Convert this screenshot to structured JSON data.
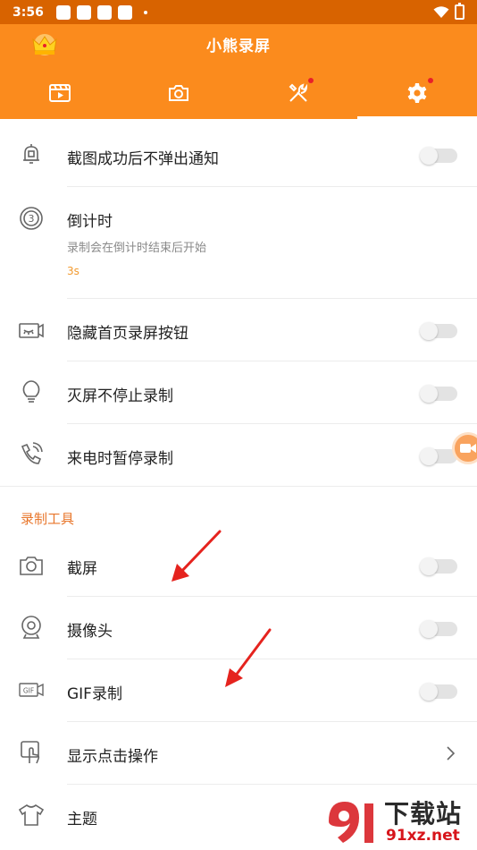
{
  "status_bar": {
    "time": "3:56"
  },
  "app_bar": {
    "title": "小熊录屏",
    "tabs": [
      {
        "icon": "video-list-icon",
        "active": false,
        "badge": false
      },
      {
        "icon": "camera-icon",
        "active": false,
        "badge": false
      },
      {
        "icon": "tools-icon",
        "active": false,
        "badge": true
      },
      {
        "icon": "gear-icon",
        "active": true,
        "badge": true
      }
    ]
  },
  "settings": {
    "screenshot_notify": {
      "label": "截图成功后不弹出通知",
      "enabled": false
    },
    "countdown": {
      "label": "倒计时",
      "description": "录制会在倒计时结束后开始",
      "value": "3s"
    },
    "hide_record_button": {
      "label": "隐藏首页录屏按钮",
      "enabled": false
    },
    "screen_off_recording": {
      "label": "灭屏不停止录制",
      "enabled": false
    },
    "pause_on_call": {
      "label": "来电时暂停录制",
      "enabled": false
    }
  },
  "recording_tools": {
    "section_title": "录制工具",
    "items": [
      {
        "label": "截屏",
        "icon": "camera-icon",
        "enabled": false
      },
      {
        "label": "摄像头",
        "icon": "webcam-icon",
        "enabled": false
      },
      {
        "label": "GIF录制",
        "icon": "gif-icon",
        "enabled": false
      },
      {
        "label": "显示点击操作",
        "icon": "tap-icon"
      },
      {
        "label": "主题",
        "icon": "tshirt-icon"
      }
    ]
  },
  "watermark": {
    "brand_text": "下载站",
    "domain_text": "91xz.net"
  },
  "colors": {
    "primary": "#fb8b1d",
    "status_bar": "#d86300",
    "accent_text": "#e8762b",
    "annotation_arrow": "#e5231e"
  }
}
